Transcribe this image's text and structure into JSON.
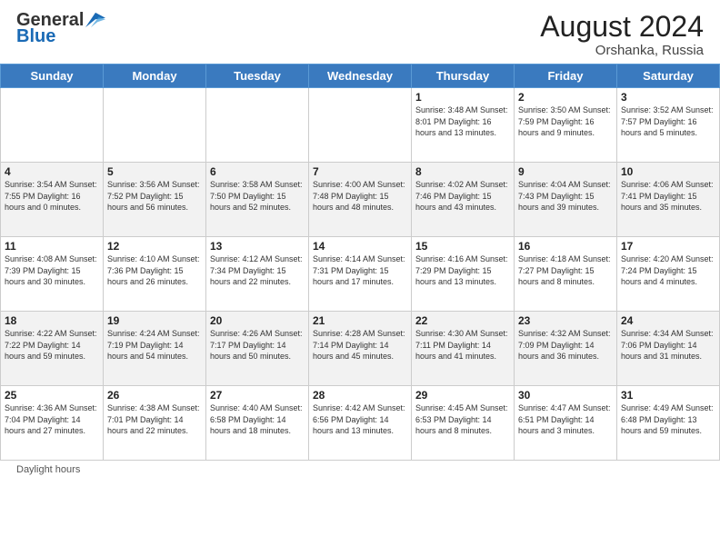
{
  "header": {
    "logo_general": "General",
    "logo_blue": "Blue",
    "month_year": "August 2024",
    "location": "Orshanka, Russia"
  },
  "footer": {
    "daylight_hours_label": "Daylight hours"
  },
  "days_of_week": [
    "Sunday",
    "Monday",
    "Tuesday",
    "Wednesday",
    "Thursday",
    "Friday",
    "Saturday"
  ],
  "weeks": [
    [
      {
        "day": "",
        "info": ""
      },
      {
        "day": "",
        "info": ""
      },
      {
        "day": "",
        "info": ""
      },
      {
        "day": "",
        "info": ""
      },
      {
        "day": "1",
        "info": "Sunrise: 3:48 AM\nSunset: 8:01 PM\nDaylight: 16 hours\nand 13 minutes."
      },
      {
        "day": "2",
        "info": "Sunrise: 3:50 AM\nSunset: 7:59 PM\nDaylight: 16 hours\nand 9 minutes."
      },
      {
        "day": "3",
        "info": "Sunrise: 3:52 AM\nSunset: 7:57 PM\nDaylight: 16 hours\nand 5 minutes."
      }
    ],
    [
      {
        "day": "4",
        "info": "Sunrise: 3:54 AM\nSunset: 7:55 PM\nDaylight: 16 hours\nand 0 minutes."
      },
      {
        "day": "5",
        "info": "Sunrise: 3:56 AM\nSunset: 7:52 PM\nDaylight: 15 hours\nand 56 minutes."
      },
      {
        "day": "6",
        "info": "Sunrise: 3:58 AM\nSunset: 7:50 PM\nDaylight: 15 hours\nand 52 minutes."
      },
      {
        "day": "7",
        "info": "Sunrise: 4:00 AM\nSunset: 7:48 PM\nDaylight: 15 hours\nand 48 minutes."
      },
      {
        "day": "8",
        "info": "Sunrise: 4:02 AM\nSunset: 7:46 PM\nDaylight: 15 hours\nand 43 minutes."
      },
      {
        "day": "9",
        "info": "Sunrise: 4:04 AM\nSunset: 7:43 PM\nDaylight: 15 hours\nand 39 minutes."
      },
      {
        "day": "10",
        "info": "Sunrise: 4:06 AM\nSunset: 7:41 PM\nDaylight: 15 hours\nand 35 minutes."
      }
    ],
    [
      {
        "day": "11",
        "info": "Sunrise: 4:08 AM\nSunset: 7:39 PM\nDaylight: 15 hours\nand 30 minutes."
      },
      {
        "day": "12",
        "info": "Sunrise: 4:10 AM\nSunset: 7:36 PM\nDaylight: 15 hours\nand 26 minutes."
      },
      {
        "day": "13",
        "info": "Sunrise: 4:12 AM\nSunset: 7:34 PM\nDaylight: 15 hours\nand 22 minutes."
      },
      {
        "day": "14",
        "info": "Sunrise: 4:14 AM\nSunset: 7:31 PM\nDaylight: 15 hours\nand 17 minutes."
      },
      {
        "day": "15",
        "info": "Sunrise: 4:16 AM\nSunset: 7:29 PM\nDaylight: 15 hours\nand 13 minutes."
      },
      {
        "day": "16",
        "info": "Sunrise: 4:18 AM\nSunset: 7:27 PM\nDaylight: 15 hours\nand 8 minutes."
      },
      {
        "day": "17",
        "info": "Sunrise: 4:20 AM\nSunset: 7:24 PM\nDaylight: 15 hours\nand 4 minutes."
      }
    ],
    [
      {
        "day": "18",
        "info": "Sunrise: 4:22 AM\nSunset: 7:22 PM\nDaylight: 14 hours\nand 59 minutes."
      },
      {
        "day": "19",
        "info": "Sunrise: 4:24 AM\nSunset: 7:19 PM\nDaylight: 14 hours\nand 54 minutes."
      },
      {
        "day": "20",
        "info": "Sunrise: 4:26 AM\nSunset: 7:17 PM\nDaylight: 14 hours\nand 50 minutes."
      },
      {
        "day": "21",
        "info": "Sunrise: 4:28 AM\nSunset: 7:14 PM\nDaylight: 14 hours\nand 45 minutes."
      },
      {
        "day": "22",
        "info": "Sunrise: 4:30 AM\nSunset: 7:11 PM\nDaylight: 14 hours\nand 41 minutes."
      },
      {
        "day": "23",
        "info": "Sunrise: 4:32 AM\nSunset: 7:09 PM\nDaylight: 14 hours\nand 36 minutes."
      },
      {
        "day": "24",
        "info": "Sunrise: 4:34 AM\nSunset: 7:06 PM\nDaylight: 14 hours\nand 31 minutes."
      }
    ],
    [
      {
        "day": "25",
        "info": "Sunrise: 4:36 AM\nSunset: 7:04 PM\nDaylight: 14 hours\nand 27 minutes."
      },
      {
        "day": "26",
        "info": "Sunrise: 4:38 AM\nSunset: 7:01 PM\nDaylight: 14 hours\nand 22 minutes."
      },
      {
        "day": "27",
        "info": "Sunrise: 4:40 AM\nSunset: 6:58 PM\nDaylight: 14 hours\nand 18 minutes."
      },
      {
        "day": "28",
        "info": "Sunrise: 4:42 AM\nSunset: 6:56 PM\nDaylight: 14 hours\nand 13 minutes."
      },
      {
        "day": "29",
        "info": "Sunrise: 4:45 AM\nSunset: 6:53 PM\nDaylight: 14 hours\nand 8 minutes."
      },
      {
        "day": "30",
        "info": "Sunrise: 4:47 AM\nSunset: 6:51 PM\nDaylight: 14 hours\nand 3 minutes."
      },
      {
        "day": "31",
        "info": "Sunrise: 4:49 AM\nSunset: 6:48 PM\nDaylight: 13 hours\nand 59 minutes."
      }
    ]
  ]
}
